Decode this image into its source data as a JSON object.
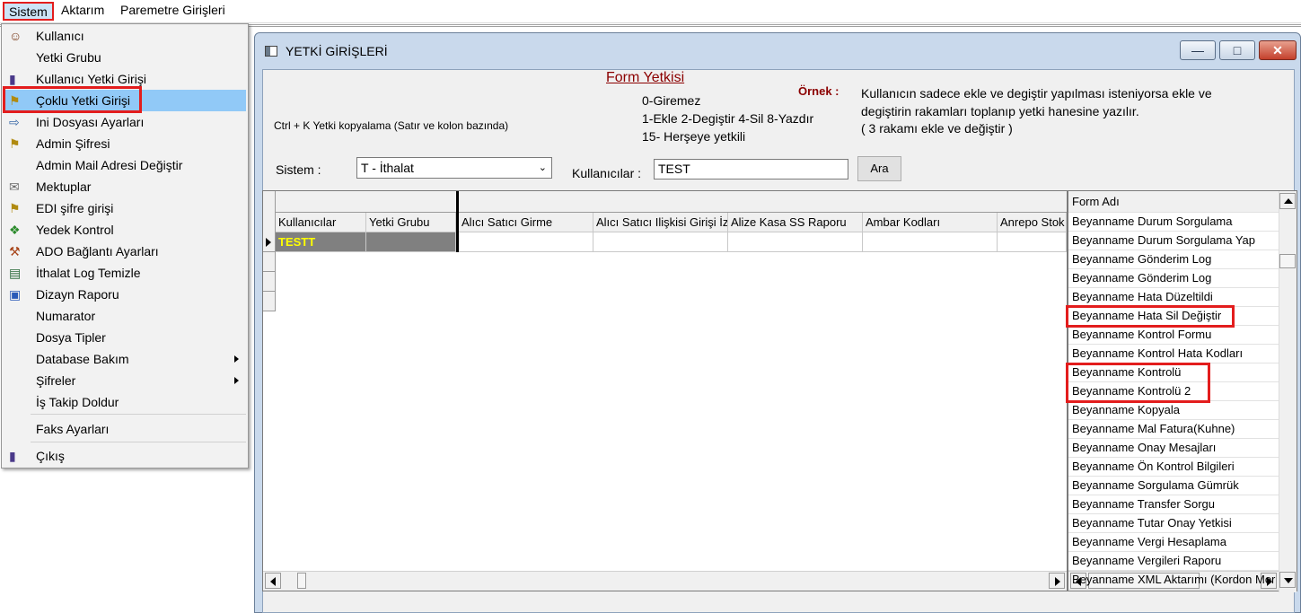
{
  "menubar": {
    "items": [
      "Sistem",
      "Aktarım",
      "Paremetre Girişleri"
    ]
  },
  "dropdown": {
    "items": [
      {
        "label": "Kullanıcı",
        "icon": "user-icon"
      },
      {
        "label": "Yetki Grubu",
        "icon": ""
      },
      {
        "label": "Kullanıcı Yetki Girişi",
        "icon": "bottle-icon"
      },
      {
        "label": "Çoklu Yetki Girişi",
        "icon": "key-icon"
      },
      {
        "label": "Ini Dosyası  Ayarları",
        "icon": "settings-file-icon"
      },
      {
        "label": "Admin Şifresi",
        "icon": "key-icon"
      },
      {
        "label": "Admin Mail Adresi Değiştir",
        "icon": ""
      },
      {
        "label": "Mektuplar",
        "icon": "letter-icon"
      },
      {
        "label": "EDI şifre girişi",
        "icon": "key-icon"
      },
      {
        "label": "Yedek Kontrol",
        "icon": "backup-icon"
      },
      {
        "label": "ADO Bağlantı Ayarları",
        "icon": "connection-icon"
      },
      {
        "label": "İthalat Log Temizle",
        "icon": "log-icon"
      },
      {
        "label": "Dizayn Raporu",
        "icon": "design-icon"
      },
      {
        "label": "Numarator",
        "icon": ""
      },
      {
        "label": "Dosya Tipler",
        "icon": ""
      },
      {
        "label": "Database Bakım",
        "icon": ""
      },
      {
        "label": "Şifreler",
        "icon": ""
      },
      {
        "label": "İş Takip Doldur",
        "icon": ""
      },
      {
        "label": "Faks Ayarları",
        "icon": ""
      },
      {
        "label": "Çıkış",
        "icon": "exit-icon"
      }
    ]
  },
  "window": {
    "title": "YETKİ GİRİŞLERİ",
    "form_yetkisi": "Form Yetkisi",
    "codes": [
      "0-Giremez",
      "1-Ekle  2-Degiştir  4-Sil  8-Yazdır",
      "15- Herşeye yetkili"
    ],
    "ornek": "Örnek :",
    "example_lines": [
      "Kullanıcın sadece ekle ve degiştir yapılması isteniyorsa  ekle ve",
      "degiştirin rakamları toplanıp yetki hanesine yazılır.",
      " ( 3 rakamı ekle ve değiştir )"
    ],
    "copy_hint": "Ctrl + K Yetki kopyalama (Satır ve kolon bazında)",
    "sistem_label": "Sistem :",
    "sistem_value": "T - İthalat",
    "kullanicilar_label": "Kullanıcılar :",
    "kullanicilar_value": "TEST",
    "ara_button": "Ara"
  },
  "grid": {
    "columns": [
      "Kullanıcılar",
      "Yetki Grubu",
      "Alıcı Satıcı Girme",
      "Alıcı Satıcı Ilişkisi Girişi İz",
      "Alize Kasa SS Raporu",
      "Ambar Kodları",
      "Anrepo Stok"
    ],
    "rows": [
      [
        "TESTT",
        "",
        "",
        "",
        "",
        "",
        ""
      ]
    ]
  },
  "form_list": {
    "header": "Form Adı",
    "items": [
      "Beyanname Durum Sorgulama",
      "Beyanname Durum Sorgulama Yap",
      "Beyanname Gönderim Log",
      "Beyanname Gönderim Log",
      "Beyanname Hata Düzeltildi",
      "Beyanname Hata Sil Değiştir",
      "Beyanname Kontrol Formu",
      "Beyanname Kontrol Hata Kodları",
      "Beyanname Kontrolü",
      "Beyanname Kontrolü 2",
      "Beyanname Kopyala",
      "Beyanname Mal Fatura(Kuhne)",
      "Beyanname Onay Mesajları",
      "Beyanname Ön Kontrol Bilgileri",
      "Beyanname Sorgulama Gümrük",
      "Beyanname Transfer Sorgu",
      "Beyanname Tutar Onay Yetkisi",
      "Beyanname Vergi Hesaplama",
      "Beyanname Vergileri Raporu",
      "Beyanname XML Aktarımı (Kordon Mor"
    ]
  },
  "colors": {
    "highlight": "#91c9f7",
    "annotation": "#e31d1d",
    "title_red": "#8b0000",
    "selected_cell_text": "#ffff00"
  }
}
